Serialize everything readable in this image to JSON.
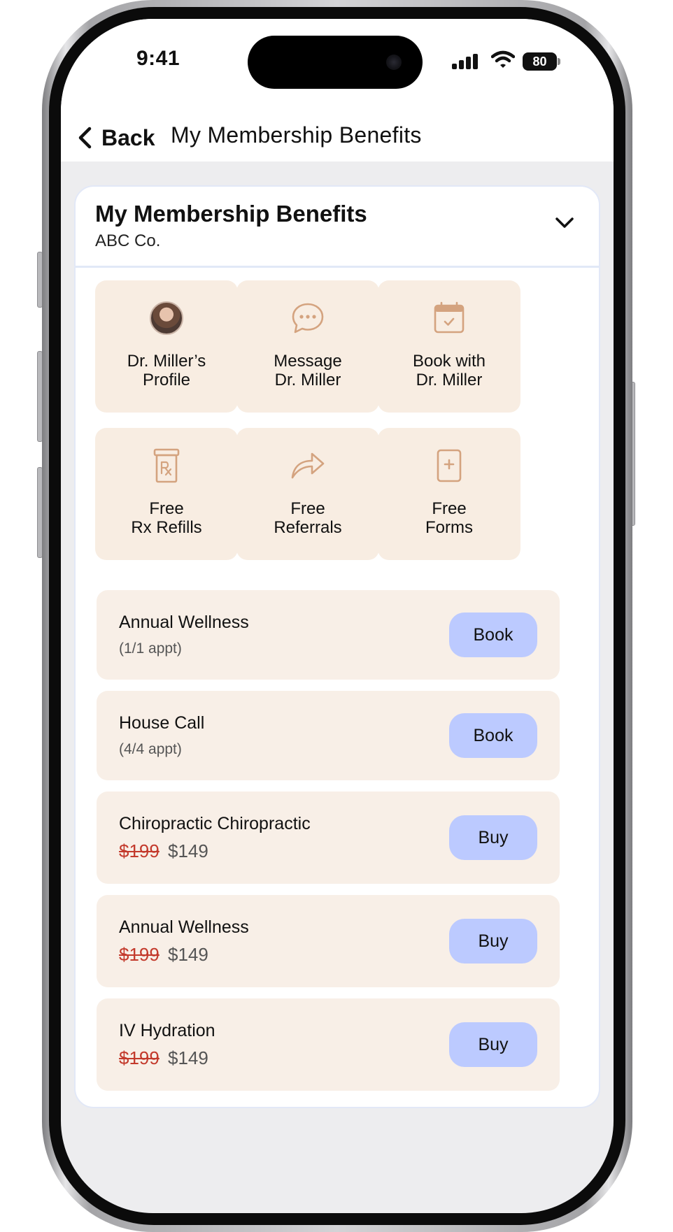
{
  "status_bar": {
    "time": "9:41",
    "battery": "80"
  },
  "header": {
    "back_label": "Back",
    "title": "My Membership Benefits"
  },
  "card": {
    "title": "My Membership Benefits",
    "subtitle": "ABC Co."
  },
  "tiles": [
    {
      "line1": "Dr. Miller’s",
      "line2": "Profile",
      "icon": "avatar"
    },
    {
      "line1": "Message",
      "line2": "Dr. Miller",
      "icon": "chat-bubble-icon"
    },
    {
      "line1": "Book with",
      "line2": "Dr. Miller",
      "icon": "calendar-check-icon"
    },
    {
      "line1": "Free",
      "line2": "Rx Refills",
      "icon": "rx-bottle-icon"
    },
    {
      "line1": "Free",
      "line2": "Referrals",
      "icon": "share-arrow-icon"
    },
    {
      "line1": "Free",
      "line2": "Forms",
      "icon": "document-plus-icon"
    }
  ],
  "benefits": [
    {
      "title": "Annual Wellness",
      "sub": "(1/1 appt)",
      "button": "Book"
    },
    {
      "title": "House Call",
      "sub": "(4/4 appt)",
      "button": "Book"
    },
    {
      "title": "Chiropractic Chiropractic",
      "old_price": "$199",
      "price": "$149",
      "button": "Buy"
    },
    {
      "title": "Annual Wellness",
      "old_price": "$199",
      "price": "$149",
      "button": "Buy"
    },
    {
      "title": "IV Hydration",
      "old_price": "$199",
      "price": "$149",
      "button": "Buy"
    }
  ],
  "colors": {
    "accent_icon": "#d4a37f",
    "tile_bg": "#f8ede2",
    "button_bg": "#bccaff",
    "old_price": "#c33a2c"
  }
}
